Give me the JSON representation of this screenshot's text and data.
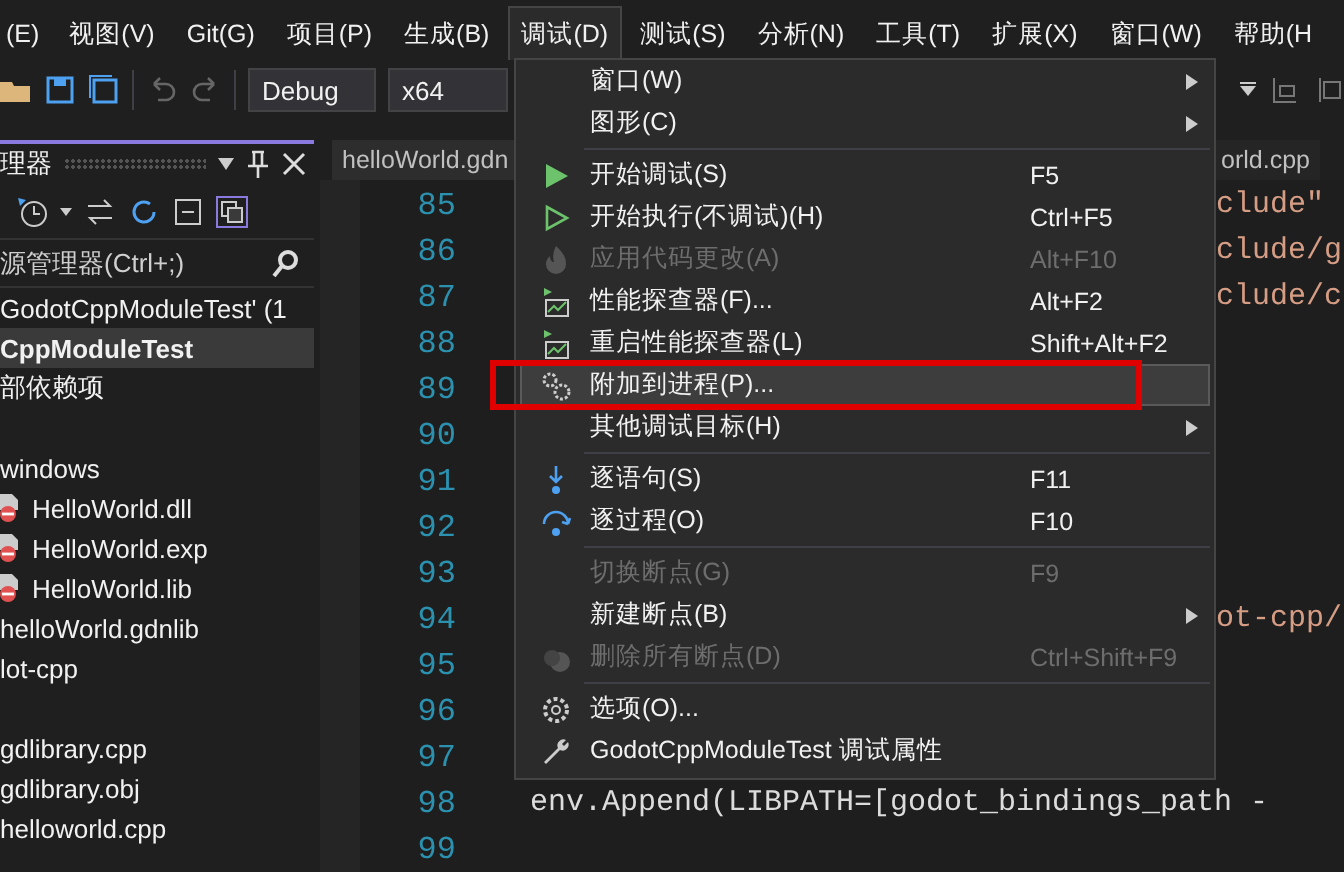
{
  "menu_bar": [
    {
      "label": "(E)",
      "selected": false
    },
    {
      "label": "视图(V)",
      "selected": false
    },
    {
      "label": "Git(G)",
      "selected": false
    },
    {
      "label": "项目(P)",
      "selected": false
    },
    {
      "label": "生成(B)",
      "selected": false
    },
    {
      "label": "调试(D)",
      "selected": true
    },
    {
      "label": "测试(S)",
      "selected": false
    },
    {
      "label": "分析(N)",
      "selected": false
    },
    {
      "label": "工具(T)",
      "selected": false
    },
    {
      "label": "扩展(X)",
      "selected": false
    },
    {
      "label": "窗口(W)",
      "selected": false
    },
    {
      "label": "帮助(H",
      "selected": false
    }
  ],
  "toolbar": {
    "configuration": "Debug",
    "platform": "x64"
  },
  "solution_explorer": {
    "title": "理器",
    "search": {
      "placeholder": "源管理器(Ctrl+;)"
    },
    "items": [
      {
        "label": "GodotCppModuleTest' (1",
        "selected": false,
        "bold": false,
        "kind": "plain"
      },
      {
        "label": "CppModuleTest",
        "selected": true,
        "bold": true,
        "kind": "plain"
      },
      {
        "label": "部依赖项",
        "selected": false,
        "bold": false,
        "kind": "plain"
      },
      {
        "selected": false,
        "kind": "blank"
      },
      {
        "label": "windows",
        "selected": false,
        "bold": false,
        "kind": "plain"
      },
      {
        "label": "HelloWorld.dll",
        "selected": false,
        "bold": false,
        "kind": "excluded"
      },
      {
        "label": "HelloWorld.exp",
        "selected": false,
        "bold": false,
        "kind": "excluded"
      },
      {
        "label": "HelloWorld.lib",
        "selected": false,
        "bold": false,
        "kind": "excluded"
      },
      {
        "label": "helloWorld.gdnlib",
        "selected": false,
        "bold": false,
        "kind": "plain"
      },
      {
        "label": "lot-cpp",
        "selected": false,
        "bold": false,
        "kind": "plain"
      },
      {
        "selected": false,
        "kind": "blank"
      },
      {
        "label": "gdlibrary.cpp",
        "selected": false,
        "bold": false,
        "kind": "plain"
      },
      {
        "label": "gdlibrary.obj",
        "selected": false,
        "bold": false,
        "kind": "plain"
      },
      {
        "label": "helloworld.cpp",
        "selected": false,
        "bold": false,
        "kind": "plain"
      }
    ]
  },
  "editor": {
    "tabs": [
      {
        "label": "helloWorld.gdn",
        "selected": true
      },
      {
        "label": "orld.cpp",
        "selected": false
      }
    ],
    "lines": [
      {
        "number": "85",
        "text": "clude\"",
        "kind": "tail"
      },
      {
        "number": "86",
        "text": "clude/g",
        "kind": "tail"
      },
      {
        "number": "87",
        "text": "clude/c",
        "kind": "tail"
      },
      {
        "number": "88"
      },
      {
        "number": "89"
      },
      {
        "number": "90"
      },
      {
        "number": "91"
      },
      {
        "number": "92"
      },
      {
        "number": "93"
      },
      {
        "number": "94",
        "text": "ot-cpp/",
        "kind": "tail"
      },
      {
        "number": "95"
      },
      {
        "number": "96"
      },
      {
        "number": "97"
      },
      {
        "number": "98",
        "text": "env.Append(LIBPATH=[godot_bindings_path -",
        "kind": "full"
      },
      {
        "number": "99"
      }
    ]
  },
  "debug_menu": {
    "groups": [
      [
        {
          "label": "窗口(W)",
          "submenu": true,
          "disabled": false,
          "selected": false,
          "annotated": false
        },
        {
          "label": "图形(C)",
          "submenu": true,
          "disabled": false,
          "selected": false,
          "annotated": false
        }
      ],
      [
        {
          "label": "开始调试(S)",
          "shortcut": "F5",
          "submenu": false,
          "disabled": false,
          "selected": false,
          "annotated": false
        },
        {
          "label": "开始执行(不调试)(H)",
          "shortcut": "Ctrl+F5",
          "submenu": false,
          "disabled": false,
          "selected": false,
          "annotated": false
        },
        {
          "label": "应用代码更改(A)",
          "shortcut": "Alt+F10",
          "submenu": false,
          "disabled": true,
          "selected": false,
          "annotated": false
        },
        {
          "label": "性能探查器(F)...",
          "shortcut": "Alt+F2",
          "submenu": false,
          "disabled": false,
          "selected": false,
          "annotated": false
        },
        {
          "label": "重启性能探查器(L)",
          "shortcut": "Shift+Alt+F2",
          "submenu": false,
          "disabled": false,
          "selected": false,
          "annotated": false
        },
        {
          "label": "附加到进程(P)...",
          "submenu": false,
          "disabled": false,
          "selected": true,
          "annotated": true
        },
        {
          "label": "其他调试目标(H)",
          "submenu": true,
          "disabled": false,
          "selected": false,
          "annotated": false
        }
      ],
      [
        {
          "label": "逐语句(S)",
          "shortcut": "F11",
          "submenu": false,
          "disabled": false,
          "selected": false,
          "annotated": false
        },
        {
          "label": "逐过程(O)",
          "shortcut": "F10",
          "submenu": false,
          "disabled": false,
          "selected": false,
          "annotated": false
        }
      ],
      [
        {
          "label": "切换断点(G)",
          "shortcut": "F9",
          "submenu": false,
          "disabled": true,
          "selected": false,
          "annotated": false
        },
        {
          "label": "新建断点(B)",
          "submenu": true,
          "disabled": false,
          "selected": false,
          "annotated": false
        },
        {
          "label": "删除所有断点(D)",
          "shortcut": "Ctrl+Shift+F9",
          "submenu": false,
          "disabled": true,
          "selected": false,
          "annotated": false
        }
      ],
      [
        {
          "label": "选项(O)...",
          "submenu": false,
          "disabled": false,
          "selected": false,
          "annotated": false
        },
        {
          "label": "GodotCppModuleTest 调试属性",
          "submenu": false,
          "disabled": false,
          "selected": false,
          "annotated": false
        }
      ]
    ]
  }
}
